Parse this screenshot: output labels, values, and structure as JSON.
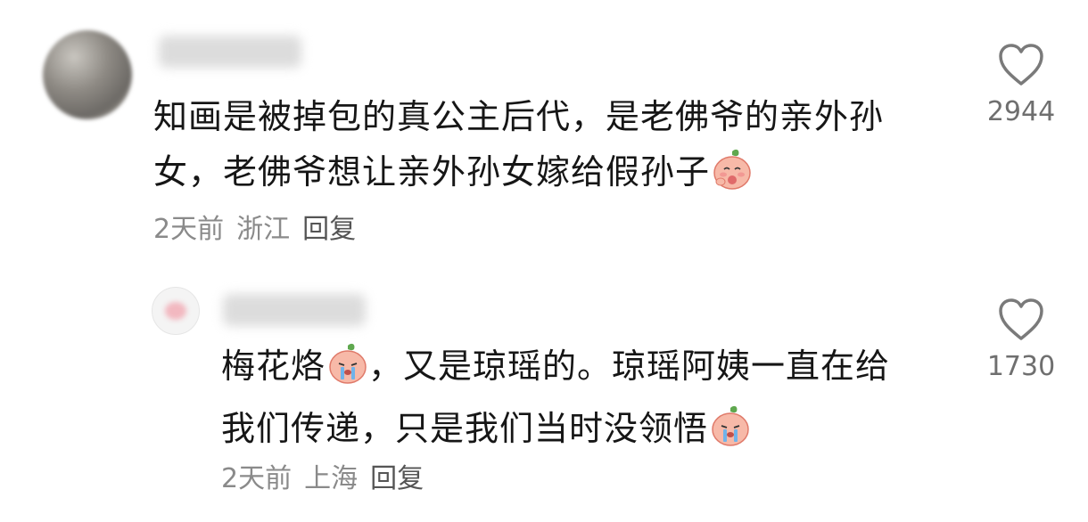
{
  "comments": [
    {
      "text_line1": "知画是被掉包的真公主后代，是老佛爷的亲外孙",
      "text_line2": "女，老佛爷想让亲外孙女嫁给假孙子",
      "time": "2天前",
      "location": "浙江",
      "reply_label": "回复",
      "likes": "2944",
      "emoji": "peach-shy-emoji"
    },
    {
      "text_line1_a": "梅花烙",
      "text_line1_b": "，又是琼瑶的。琼瑶阿姨一直在给",
      "text_line2": "我们传递，只是我们当时没领悟",
      "time": "2天前",
      "location": "上海",
      "reply_label": "回复",
      "likes": "1730",
      "emoji": "peach-crying-emoji"
    }
  ]
}
